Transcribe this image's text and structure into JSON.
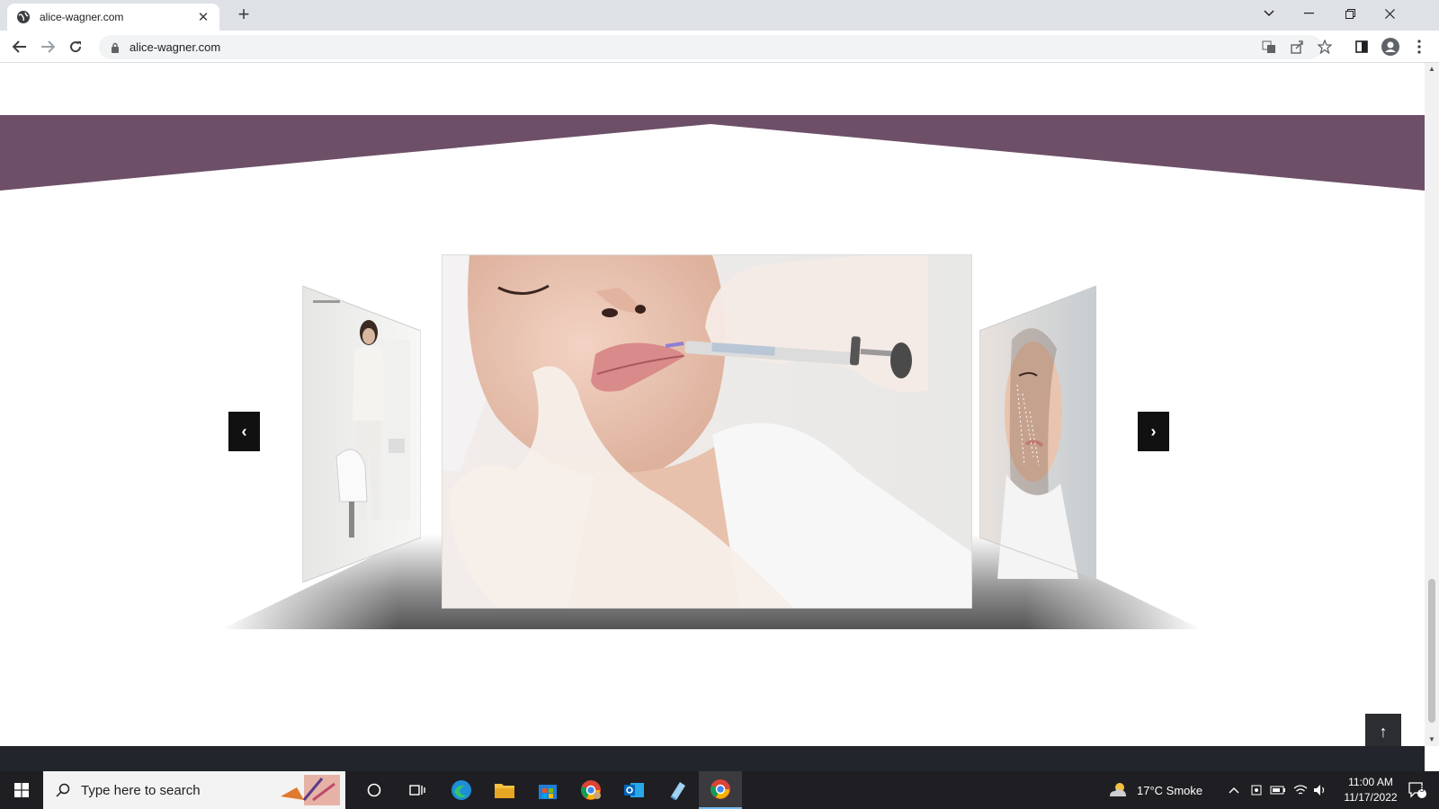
{
  "browser": {
    "tab_title": "alice-wagner.com",
    "url": "alice-wagner.com",
    "new_tab_label": "+",
    "close_tab_label": "✕"
  },
  "page": {
    "banner_color": "#6e4f68",
    "carousel": {
      "prev_label": "‹",
      "next_label": "›",
      "slides": [
        {
          "name": "woman-in-clinic-photo"
        },
        {
          "name": "lip-filler-injection-photo"
        },
        {
          "name": "facial-treatment-photo"
        }
      ]
    },
    "back_to_top_label": "↑"
  },
  "taskbar": {
    "search_placeholder": "Type here to search",
    "weather": "17°C  Smoke",
    "time": "11:00 AM",
    "date": "11/17/2022",
    "notification_count": "5"
  }
}
